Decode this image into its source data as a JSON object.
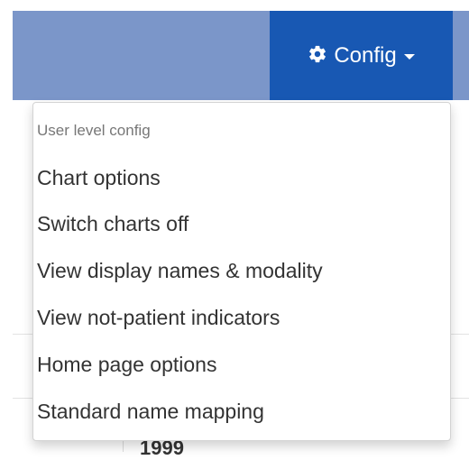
{
  "navbar": {
    "config_button": {
      "icon": "gear-icon",
      "label": "Config",
      "caret_icon": "caret-down-icon"
    }
  },
  "background": {
    "partial_text": "1999"
  },
  "dropdown": {
    "header": "User level config",
    "items": [
      {
        "label": "Chart options"
      },
      {
        "label": "Switch charts off"
      },
      {
        "label": "View display names & modality"
      },
      {
        "label": "View not-patient indicators"
      },
      {
        "label": "Home page options"
      },
      {
        "label": "Standard name mapping"
      }
    ]
  },
  "colors": {
    "navbar": "#7b96c9",
    "config_button": "#1858b3",
    "header_text": "#777777",
    "item_text": "#333333"
  }
}
